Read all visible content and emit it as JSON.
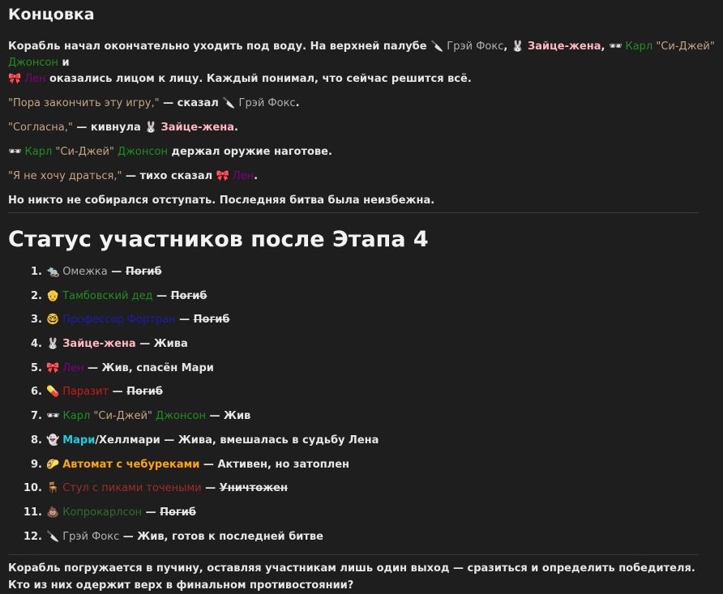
{
  "heading": "Концовка",
  "colors": {
    "grey": "#b0b0b0",
    "beige": "#c4a484",
    "pink": "#ffb6c1",
    "green": "#1e8f1e",
    "purple": "#800080",
    "blue": "#1c1cb0",
    "red": "#d01818",
    "cyan": "#18d0e0",
    "orange": "#ffa500",
    "brown": "#a52a2a",
    "darkgreen": "#2e6e2e"
  },
  "intro": {
    "t1": "Корабль начал окончательно уходить под воду. На верхней палубе ",
    "gray_fox": "Грэй Фокс",
    "comma1": ", ",
    "wife": "Зайце-жена",
    "comma2": ", ",
    "karl1": "Карл ",
    "karl2": "\"Си-Джей\"",
    "karl3": " Джонсон",
    "and": " и",
    "len": "Лен",
    "t2": " оказались лицом к лицу. Каждый понимал, что сейчас решится всё."
  },
  "line2": {
    "quote": "\"Пора закончить эту игру,\"",
    "said": " — сказал ",
    "name": "Грэй Фокс",
    "end": "."
  },
  "line3": {
    "quote": "\"Согласна,\"",
    "said": " — кивнула ",
    "name": "Зайце-жена",
    "end": "."
  },
  "line4": {
    "karl1": "Карл ",
    "karl2": "\"Си-Джей\"",
    "karl3": " Джонсон",
    "rest": " держал оружие наготове."
  },
  "line5": {
    "quote": "\"Я не хочу драться,\"",
    "said": " — тихо сказал ",
    "name": "Лен",
    "end": "."
  },
  "line6": "Но никто не собирался отступать. Последняя битва была неизбежна.",
  "status_heading": "Статус участников после Этапа 4",
  "participants": [
    {
      "num": "1.",
      "icon": "🐀",
      "name": "Омежка",
      "status": "Погиб"
    },
    {
      "num": "2.",
      "icon": "👴",
      "name": "Тамбовский дед",
      "status": "Погиб"
    },
    {
      "num": "3.",
      "icon": "🤓",
      "name": "Профессор Фортран",
      "status": "Погиб"
    },
    {
      "num": "4.",
      "icon": "🐰",
      "name": "Зайце-жена",
      "status": "Жива"
    },
    {
      "num": "5.",
      "icon": "🎀",
      "name": "Лен",
      "status": "Жив, спасён Мари"
    },
    {
      "num": "6.",
      "icon": "💊",
      "name": "Паразит",
      "status": "Погиб"
    },
    {
      "num": "7.",
      "icon": "🕶",
      "name1": "Карл ",
      "name2": "\"Си-Джей\"",
      "name3": " Джонсон",
      "status": "Жив"
    },
    {
      "num": "8.",
      "icon": "👻",
      "name_a": "Мари",
      "name_b": "/Хеллмари",
      "status": "Жива, вмешалась в судьбу Лена"
    },
    {
      "num": "9.",
      "icon": "🌮",
      "name": "Автомат с чебуреками",
      "status": "Активен, но затоплен"
    },
    {
      "num": "10.",
      "icon": "🪑",
      "name": "Стул с пиками точеными",
      "status": "Уничтожен"
    },
    {
      "num": "11.",
      "icon": "💩",
      "name": "Копрокарлсон",
      "status": "Погиб"
    },
    {
      "num": "12.",
      "icon": "🔪",
      "name": "Грэй Фокс",
      "status": "Жив, готов к последней битве"
    }
  ],
  "dash": " — ",
  "final": "Корабль погружается в пучину, оставляя участникам лишь один выход — сразиться и определить победителя. Кто из них одержит верх в финальном противостоянии?",
  "icons": {
    "knife": "🔪",
    "rabbit": "🐰",
    "glasses": "🕶",
    "bow": "🎀"
  }
}
